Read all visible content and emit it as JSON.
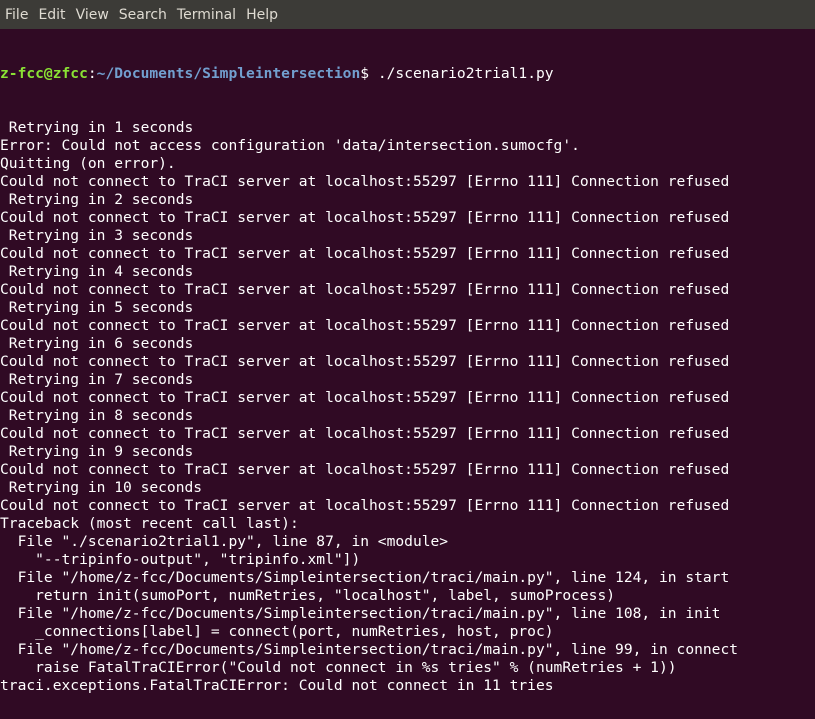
{
  "menu": [
    "File",
    "Edit",
    "View",
    "Search",
    "Terminal",
    "Help"
  ],
  "prompt": {
    "user": "z-fcc@zfcc",
    "colon": ":",
    "path": "~/Documents/Simpleintersection",
    "dollar": "$"
  },
  "command": " ./scenario2trial1.py",
  "lines": [
    " Retrying in 1 seconds",
    "Error: Could not access configuration 'data/intersection.sumocfg'.",
    "Quitting (on error).",
    "Could not connect to TraCI server at localhost:55297 [Errno 111] Connection refused",
    " Retrying in 2 seconds",
    "Could not connect to TraCI server at localhost:55297 [Errno 111] Connection refused",
    " Retrying in 3 seconds",
    "Could not connect to TraCI server at localhost:55297 [Errno 111] Connection refused",
    " Retrying in 4 seconds",
    "Could not connect to TraCI server at localhost:55297 [Errno 111] Connection refused",
    " Retrying in 5 seconds",
    "Could not connect to TraCI server at localhost:55297 [Errno 111] Connection refused",
    " Retrying in 6 seconds",
    "Could not connect to TraCI server at localhost:55297 [Errno 111] Connection refused",
    " Retrying in 7 seconds",
    "Could not connect to TraCI server at localhost:55297 [Errno 111] Connection refused",
    " Retrying in 8 seconds",
    "Could not connect to TraCI server at localhost:55297 [Errno 111] Connection refused",
    " Retrying in 9 seconds",
    "Could not connect to TraCI server at localhost:55297 [Errno 111] Connection refused",
    " Retrying in 10 seconds",
    "Could not connect to TraCI server at localhost:55297 [Errno 111] Connection refused",
    "Traceback (most recent call last):",
    "  File \"./scenario2trial1.py\", line 87, in <module>",
    "    \"--tripinfo-output\", \"tripinfo.xml\"])",
    "  File \"/home/z-fcc/Documents/Simpleintersection/traci/main.py\", line 124, in start",
    "    return init(sumoPort, numRetries, \"localhost\", label, sumoProcess)",
    "  File \"/home/z-fcc/Documents/Simpleintersection/traci/main.py\", line 108, in init",
    "    _connections[label] = connect(port, numRetries, host, proc)",
    "  File \"/home/z-fcc/Documents/Simpleintersection/traci/main.py\", line 99, in connect",
    "    raise FatalTraCIError(\"Could not connect in %s tries\" % (numRetries + 1))",
    "traci.exceptions.FatalTraCIError: Could not connect in 11 tries"
  ]
}
